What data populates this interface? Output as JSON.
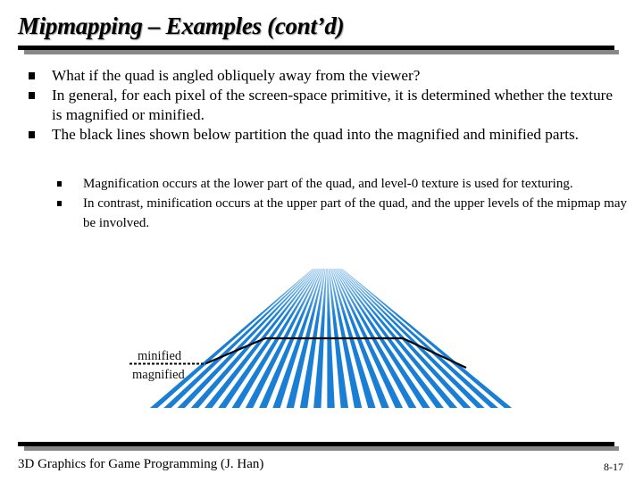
{
  "slide": {
    "title": "Mipmapping – Examples (cont’d)",
    "bullets": [
      "What if the quad is angled obliquely away from the viewer?",
      "In general, for each pixel of the screen-space primitive, it is determined whether the texture is magnified or minified.",
      "The black lines shown below partition the quad into the magnified and minified parts."
    ],
    "sub_bullets": [
      "Magnification occurs at the lower part of the quad, and level-0 texture is used for texturing.",
      "In contrast, minification occurs at the upper part of the quad, and the upper levels of the mipmap may be involved."
    ],
    "bullet_icon": "square-bullet-icon"
  },
  "figure": {
    "label_minified": "minified",
    "label_magnified": "magnified",
    "stripe_color": "#1a7fd4",
    "partition_line_color": "#000000",
    "stripe_count": 27
  },
  "footer": {
    "left": "3D Graphics for Game Programming (J. Han)",
    "page": "8-17"
  },
  "colors": {
    "rule_black": "#000000",
    "rule_gray": "#888888"
  }
}
